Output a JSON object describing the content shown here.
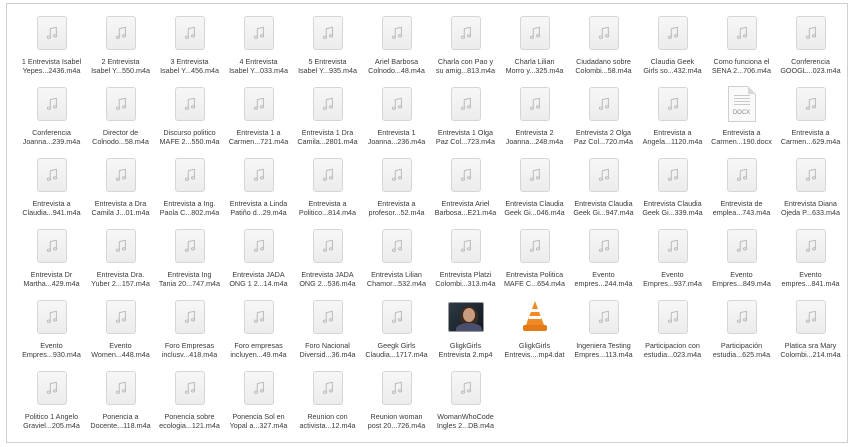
{
  "files": [
    {
      "line1": "1 Entrevista Isabel",
      "line2": "Yepes...2436.m4a",
      "kind": "audio"
    },
    {
      "line1": "2 Entrevista",
      "line2": "Isabel Y...550.m4a",
      "kind": "audio"
    },
    {
      "line1": "3 Entrevista",
      "line2": "Isabel Y...456.m4a",
      "kind": "audio"
    },
    {
      "line1": "4 Entrevista",
      "line2": "Isabel Y...033.m4a",
      "kind": "audio"
    },
    {
      "line1": "5 Entrevista",
      "line2": "Isabel Y...935.m4a",
      "kind": "audio"
    },
    {
      "line1": "Ariel Barbosa",
      "line2": "Colnodo...48.m4a",
      "kind": "audio"
    },
    {
      "line1": "Charla con Pao y",
      "line2": "su amig...813.m4a",
      "kind": "audio"
    },
    {
      "line1": "Charla Lilian",
      "line2": "Morro y...325.m4a",
      "kind": "audio"
    },
    {
      "line1": "Ciudadano sobre",
      "line2": "Colombi...58.m4a",
      "kind": "audio"
    },
    {
      "line1": "Claudia Geek",
      "line2": "Girls so...432.m4a",
      "kind": "audio"
    },
    {
      "line1": "Como funciona el",
      "line2": "SENA 2...706.m4a",
      "kind": "audio"
    },
    {
      "line1": "Conferencia",
      "line2": "GOOGL...023.m4a",
      "kind": "audio"
    },
    {
      "line1": "Conferencia",
      "line2": "Joanna...239.m4a",
      "kind": "audio"
    },
    {
      "line1": "Director de",
      "line2": "Colnodo...58.m4a",
      "kind": "audio"
    },
    {
      "line1": "Discurso politico",
      "line2": "MAFE 2...550.m4a",
      "kind": "audio"
    },
    {
      "line1": "Entrevista 1 a",
      "line2": "Carmen...721.m4a",
      "kind": "audio"
    },
    {
      "line1": "Entrevista 1 Dra",
      "line2": "Camila...2801.m4a",
      "kind": "audio"
    },
    {
      "line1": "Entrevista 1",
      "line2": "Joanna...236.m4a",
      "kind": "audio"
    },
    {
      "line1": "Entrevista 1 Olga",
      "line2": "Paz Col...723.m4a",
      "kind": "audio"
    },
    {
      "line1": "Entrevista 2",
      "line2": "Joanna...248.m4a",
      "kind": "audio"
    },
    {
      "line1": "Entrevista 2 Olga",
      "line2": "Paz Col...720.m4a",
      "kind": "audio"
    },
    {
      "line1": "Entrevista a",
      "line2": "Angela...1120.m4a",
      "kind": "audio"
    },
    {
      "line1": "Entrevista a",
      "line2": "Carmen...190.docx",
      "kind": "docx",
      "tag": "DOCX"
    },
    {
      "line1": "Entrevista a",
      "line2": "Carmen...629.m4a",
      "kind": "audio"
    },
    {
      "line1": "Entrevista a",
      "line2": "Claudia...941.m4a",
      "kind": "audio"
    },
    {
      "line1": "Entrevista a Dra",
      "line2": "Camila J...01.m4a",
      "kind": "audio"
    },
    {
      "line1": "Entrevista a Ing.",
      "line2": "Paola C...802.m4a",
      "kind": "audio"
    },
    {
      "line1": "Entrevista a Linda",
      "line2": "Patiño d...29.m4a",
      "kind": "audio"
    },
    {
      "line1": "Entrevista a",
      "line2": "Politico...814.m4a",
      "kind": "audio"
    },
    {
      "line1": "Entrevista a",
      "line2": "profesor...52.m4a",
      "kind": "audio"
    },
    {
      "line1": "Entrevista Ariel",
      "line2": "Barbosa...E21.m4a",
      "kind": "audio"
    },
    {
      "line1": "Entrevista Claudia",
      "line2": "Geek Gi...046.m4a",
      "kind": "audio"
    },
    {
      "line1": "Entrevista Claudia",
      "line2": "Geek Gi...947.m4a",
      "kind": "audio"
    },
    {
      "line1": "Entrevista Claudia",
      "line2": "Geek Gi...339.m4a",
      "kind": "audio"
    },
    {
      "line1": "Entrevista de",
      "line2": "emplea...743.m4a",
      "kind": "audio"
    },
    {
      "line1": "Entrevista Diana",
      "line2": "Ojeda P...633.m4a",
      "kind": "audio"
    },
    {
      "line1": "Entrevista Dr",
      "line2": "Martha...429.m4a",
      "kind": "audio"
    },
    {
      "line1": "Entrevista Dra.",
      "line2": "Yuber 2...157.m4a",
      "kind": "audio"
    },
    {
      "line1": "Entrevista Ing",
      "line2": "Tania 20...747.m4a",
      "kind": "audio"
    },
    {
      "line1": "Entrevista JADA",
      "line2": "ONG 1 2...14.m4a",
      "kind": "audio"
    },
    {
      "line1": "Entrevista JADA",
      "line2": "ONG 2...536.m4a",
      "kind": "audio"
    },
    {
      "line1": "Entrevista Lilian",
      "line2": "Chamor...532.m4a",
      "kind": "audio"
    },
    {
      "line1": "Entrevista Platzi",
      "line2": "Colombi...313.m4a",
      "kind": "audio"
    },
    {
      "line1": "Entrevista Politica",
      "line2": "MAFE C...654.m4a",
      "kind": "audio"
    },
    {
      "line1": "Evento",
      "line2": "empres...244.m4a",
      "kind": "audio"
    },
    {
      "line1": "Evento",
      "line2": "Empres...937.m4a",
      "kind": "audio"
    },
    {
      "line1": "Evento",
      "line2": "Empres...849.m4a",
      "kind": "audio"
    },
    {
      "line1": "Evento",
      "line2": "empres...841.m4a",
      "kind": "audio"
    },
    {
      "line1": "Evento",
      "line2": "Empres...930.m4a",
      "kind": "audio"
    },
    {
      "line1": "Evento",
      "line2": "Women...448.m4a",
      "kind": "audio"
    },
    {
      "line1": "Foro Empresas",
      "line2": "inclusv...418.m4a",
      "kind": "audio"
    },
    {
      "line1": "Foro empresas",
      "line2": "incluyen...49.m4a",
      "kind": "audio"
    },
    {
      "line1": "Foro Nacional",
      "line2": "Diversid...36.m4a",
      "kind": "audio"
    },
    {
      "line1": "Geegk Girls",
      "line2": "Claudia...1717.m4a",
      "kind": "audio"
    },
    {
      "line1": "GligkGirls",
      "line2": "Entrevista 2.mp4",
      "kind": "video"
    },
    {
      "line1": "GligkGirls",
      "line2": "Entrevis....mp4.dat",
      "kind": "vlc"
    },
    {
      "line1": "Ingeniera Testing",
      "line2": "Empres...113.m4a",
      "kind": "audio"
    },
    {
      "line1": "Participacion con",
      "line2": "estudia...023.m4a",
      "kind": "audio"
    },
    {
      "line1": "Participación",
      "line2": "estudia...625.m4a",
      "kind": "audio"
    },
    {
      "line1": "Platica sra Mary",
      "line2": "Colombi...214.m4a",
      "kind": "audio"
    },
    {
      "line1": "Politico 1 Angelo",
      "line2": "Graviel...205.m4a",
      "kind": "audio"
    },
    {
      "line1": "Ponencia a",
      "line2": "Docente...118.m4a",
      "kind": "audio"
    },
    {
      "line1": "Ponencia sobre",
      "line2": "ecologia...121.m4a",
      "kind": "audio"
    },
    {
      "line1": "Ponencia Sol en",
      "line2": "Yopal a...327.m4a",
      "kind": "audio"
    },
    {
      "line1": "Reunion con",
      "line2": "activista...12.m4a",
      "kind": "audio"
    },
    {
      "line1": "Reunion woman",
      "line2": "post 20...726.m4a",
      "kind": "audio"
    },
    {
      "line1": "WomanWhoCode",
      "line2": "Ingles 2...DB.m4a",
      "kind": "audio"
    }
  ]
}
